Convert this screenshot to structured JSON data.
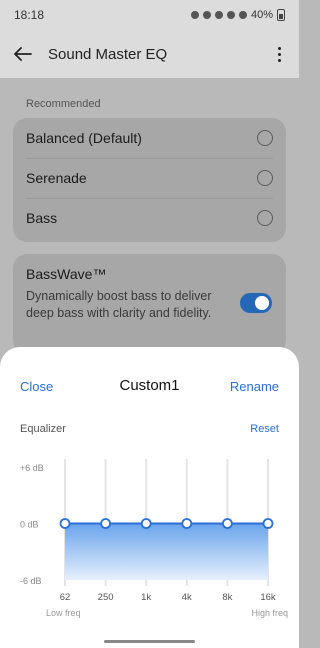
{
  "status_bar": {
    "time": "18:18",
    "battery": "40%"
  },
  "app_bar": {
    "title": "Sound Master EQ",
    "back_icon": "arrow-left-icon",
    "more_icon": "more-vertical-icon"
  },
  "recommended": {
    "label": "Recommended",
    "items": [
      {
        "label": "Balanced (Default)",
        "selected": false
      },
      {
        "label": "Serenade",
        "selected": false
      },
      {
        "label": "Bass",
        "selected": false
      }
    ]
  },
  "basswave": {
    "title": "BassWave™",
    "description": "Dynamically boost bass to deliver deep bass with clarity and fidelity.",
    "enabled": true
  },
  "sheet": {
    "close": "Close",
    "title": "Custom1",
    "rename": "Rename",
    "equalizer_label": "Equalizer",
    "reset": "Reset"
  },
  "chart_data": {
    "type": "line",
    "x": [
      "62",
      "250",
      "1k",
      "4k",
      "8k",
      "16k"
    ],
    "values": [
      0,
      0,
      0,
      0,
      0,
      0
    ],
    "y_tick_labels": [
      "+6 dB",
      "0 dB",
      "-6 dB"
    ],
    "y_ticks": [
      6,
      0,
      -6
    ],
    "ylim": [
      -6,
      6
    ],
    "x_left_caption": "Low freq",
    "x_right_caption": "High freq",
    "line_color": "#2a6fd6",
    "fill_color": "#7fb2ee"
  },
  "colors": {
    "accent": "#2a6fd6",
    "toggle_on": "#2568b8"
  }
}
